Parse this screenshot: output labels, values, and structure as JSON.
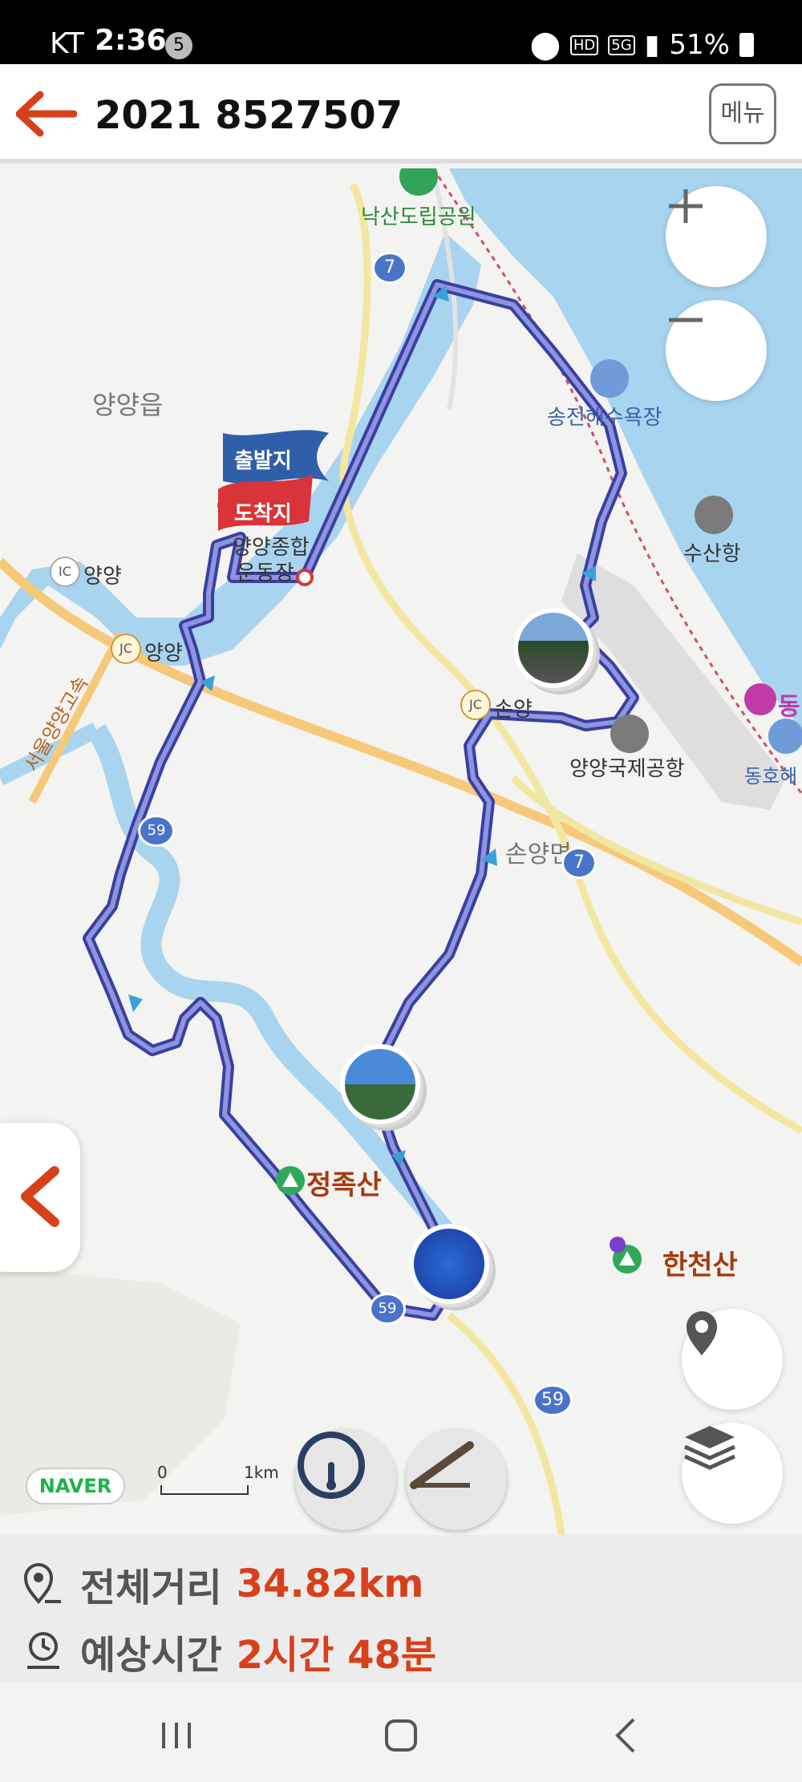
{
  "status_bar": {
    "carrier": "KT",
    "time": "2:36",
    "notification_count": "5",
    "battery": "51%"
  },
  "header": {
    "title": "2021 8527507",
    "menu_label": "메뉴"
  },
  "map": {
    "labels": {
      "naksan_park": "낙산도립공원",
      "yangyang_eup": "양양읍",
      "songjeon_beach": "송전해수욕장",
      "susan_port": "수산항",
      "yangyang_ic": "양양",
      "yangyang_jc": "양양",
      "expressway": "서울양양고속",
      "sonyang_jc": "손양",
      "airport": "양양국제공항",
      "sonyang_myeon": "손양면",
      "jeongjok_mtn": "정족산",
      "hancheon_mtn": "한천산",
      "donghae_edge": "동",
      "donghoe_edge": "동호해",
      "stadium_line1": "양양종합",
      "stadium_line2": "운동장"
    },
    "badges": {
      "ic": "IC",
      "jc": "JC",
      "jc2": "JC",
      "road_7a": "7",
      "road_7b": "7",
      "road_59": "59",
      "road_small1": "59",
      "road_small2": "59"
    },
    "flags": {
      "start": "출발지",
      "end": "도착지"
    },
    "attribution": "NAVER",
    "scale": {
      "zero": "0",
      "unit": "1km"
    },
    "colors": {
      "route": "#5660c9",
      "water": "#a8d4ef",
      "start_flag": "#2f5fa8",
      "end_flag": "#d8343a"
    }
  },
  "summary": {
    "distance_label": "전체거리",
    "distance_value": "34.82km",
    "time_label": "예상시간",
    "time_value": "2시간 48분"
  }
}
